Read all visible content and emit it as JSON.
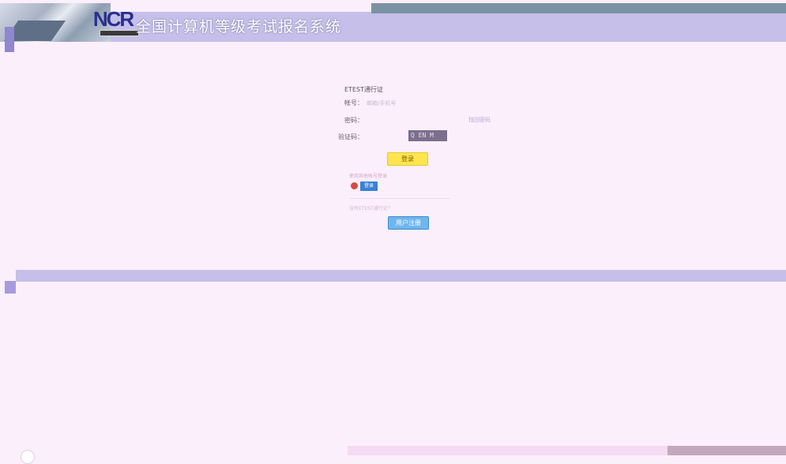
{
  "header": {
    "logo_text": "NCR",
    "title": "全国计算机等级考试报名系统"
  },
  "login": {
    "heading": "ETEST通行证",
    "account_label": "帐号：",
    "account_placeholder": "邮箱/手机号",
    "password_label": "密码：",
    "forgot_link": "找回密码",
    "captcha_label": "验证码：",
    "captcha_text": "Q EN M",
    "login_button": "登录",
    "other_login_text": "使用其他帐号登录",
    "qq_login_button": "登录",
    "register_prompt": "没有ETEST通行证？",
    "register_button": "用户注册"
  },
  "colors": {
    "page_bg": "#fbeffb",
    "band": "#c5bfea",
    "login_button": "#fde64d",
    "register_button": "#6fb6ee"
  }
}
